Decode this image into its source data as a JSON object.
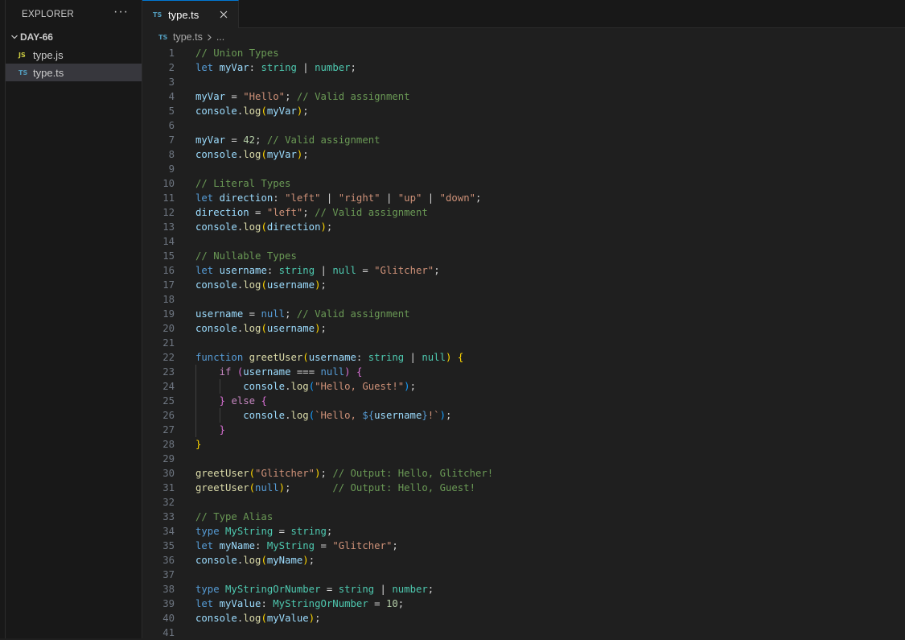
{
  "sidebar": {
    "title": "EXPLORER",
    "more_label": "···",
    "folder": "DAY-66",
    "files": [
      {
        "name": "type.js",
        "badge": "JS",
        "kind": "js",
        "selected": false
      },
      {
        "name": "type.ts",
        "badge": "TS",
        "kind": "ts",
        "selected": true
      }
    ]
  },
  "tab": {
    "badge": "TS",
    "label": "type.ts"
  },
  "breadcrumb": {
    "badge": "TS",
    "file": "type.ts",
    "tail": "..."
  },
  "colors": {
    "accent": "#0078d4",
    "comment": "#6a9955",
    "keyword": "#569cd6",
    "control": "#c586c0",
    "variable": "#9cdcfe",
    "type": "#4ec9b0",
    "string": "#ce9178",
    "number": "#b5cea8",
    "function": "#dcdcaa",
    "bracket1": "#ffd700",
    "bracket2": "#da70d6",
    "bracket3": "#179fff"
  },
  "code": {
    "lines": [
      [
        [
          "cm",
          "// Union Types"
        ]
      ],
      [
        [
          "kw",
          "let"
        ],
        [
          "op",
          " "
        ],
        [
          "var",
          "myVar"
        ],
        [
          "op",
          ": "
        ],
        [
          "ty",
          "string"
        ],
        [
          "op",
          " | "
        ],
        [
          "ty",
          "number"
        ],
        [
          "op",
          ";"
        ]
      ],
      [],
      [
        [
          "var",
          "myVar"
        ],
        [
          "op",
          " = "
        ],
        [
          "str",
          "\"Hello\""
        ],
        [
          "op",
          "; "
        ],
        [
          "cm",
          "// Valid assignment"
        ]
      ],
      [
        [
          "var",
          "console"
        ],
        [
          "op",
          "."
        ],
        [
          "fn",
          "log"
        ],
        [
          "p1",
          "("
        ],
        [
          "var",
          "myVar"
        ],
        [
          "p1",
          ")"
        ],
        [
          "op",
          ";"
        ]
      ],
      [],
      [
        [
          "var",
          "myVar"
        ],
        [
          "op",
          " = "
        ],
        [
          "num",
          "42"
        ],
        [
          "op",
          "; "
        ],
        [
          "cm",
          "// Valid assignment"
        ]
      ],
      [
        [
          "var",
          "console"
        ],
        [
          "op",
          "."
        ],
        [
          "fn",
          "log"
        ],
        [
          "p1",
          "("
        ],
        [
          "var",
          "myVar"
        ],
        [
          "p1",
          ")"
        ],
        [
          "op",
          ";"
        ]
      ],
      [],
      [
        [
          "cm",
          "// Literal Types"
        ]
      ],
      [
        [
          "kw",
          "let"
        ],
        [
          "op",
          " "
        ],
        [
          "var",
          "direction"
        ],
        [
          "op",
          ": "
        ],
        [
          "str",
          "\"left\""
        ],
        [
          "op",
          " | "
        ],
        [
          "str",
          "\"right\""
        ],
        [
          "op",
          " | "
        ],
        [
          "str",
          "\"up\""
        ],
        [
          "op",
          " | "
        ],
        [
          "str",
          "\"down\""
        ],
        [
          "op",
          ";"
        ]
      ],
      [
        [
          "var",
          "direction"
        ],
        [
          "op",
          " = "
        ],
        [
          "str",
          "\"left\""
        ],
        [
          "op",
          "; "
        ],
        [
          "cm",
          "// Valid assignment"
        ]
      ],
      [
        [
          "var",
          "console"
        ],
        [
          "op",
          "."
        ],
        [
          "fn",
          "log"
        ],
        [
          "p1",
          "("
        ],
        [
          "var",
          "direction"
        ],
        [
          "p1",
          ")"
        ],
        [
          "op",
          ";"
        ]
      ],
      [],
      [
        [
          "cm",
          "// Nullable Types"
        ]
      ],
      [
        [
          "kw",
          "let"
        ],
        [
          "op",
          " "
        ],
        [
          "var",
          "username"
        ],
        [
          "op",
          ": "
        ],
        [
          "ty",
          "string"
        ],
        [
          "op",
          " | "
        ],
        [
          "ty",
          "null"
        ],
        [
          "op",
          " = "
        ],
        [
          "str",
          "\"Glitcher\""
        ],
        [
          "op",
          ";"
        ]
      ],
      [
        [
          "var",
          "console"
        ],
        [
          "op",
          "."
        ],
        [
          "fn",
          "log"
        ],
        [
          "p1",
          "("
        ],
        [
          "var",
          "username"
        ],
        [
          "p1",
          ")"
        ],
        [
          "op",
          ";"
        ]
      ],
      [],
      [
        [
          "var",
          "username"
        ],
        [
          "op",
          " = "
        ],
        [
          "kw",
          "null"
        ],
        [
          "op",
          "; "
        ],
        [
          "cm",
          "// Valid assignment"
        ]
      ],
      [
        [
          "var",
          "console"
        ],
        [
          "op",
          "."
        ],
        [
          "fn",
          "log"
        ],
        [
          "p1",
          "("
        ],
        [
          "var",
          "username"
        ],
        [
          "p1",
          ")"
        ],
        [
          "op",
          ";"
        ]
      ],
      [],
      [
        [
          "kw",
          "function"
        ],
        [
          "op",
          " "
        ],
        [
          "fn",
          "greetUser"
        ],
        [
          "p1",
          "("
        ],
        [
          "var",
          "username"
        ],
        [
          "op",
          ": "
        ],
        [
          "ty",
          "string"
        ],
        [
          "op",
          " | "
        ],
        [
          "ty",
          "null"
        ],
        [
          "p1",
          ")"
        ],
        [
          "op",
          " "
        ],
        [
          "p1",
          "{"
        ]
      ],
      [
        [
          "op",
          "    "
        ],
        [
          "ctl",
          "if"
        ],
        [
          "op",
          " "
        ],
        [
          "p2",
          "("
        ],
        [
          "var",
          "username"
        ],
        [
          "op",
          " === "
        ],
        [
          "kw",
          "null"
        ],
        [
          "p2",
          ")"
        ],
        [
          "op",
          " "
        ],
        [
          "p2",
          "{"
        ]
      ],
      [
        [
          "op",
          "        "
        ],
        [
          "var",
          "console"
        ],
        [
          "op",
          "."
        ],
        [
          "fn",
          "log"
        ],
        [
          "p3",
          "("
        ],
        [
          "str",
          "\"Hello, Guest!\""
        ],
        [
          "p3",
          ")"
        ],
        [
          "op",
          ";"
        ]
      ],
      [
        [
          "op",
          "    "
        ],
        [
          "p2",
          "}"
        ],
        [
          "op",
          " "
        ],
        [
          "ctl",
          "else"
        ],
        [
          "op",
          " "
        ],
        [
          "p2",
          "{"
        ]
      ],
      [
        [
          "op",
          "        "
        ],
        [
          "var",
          "console"
        ],
        [
          "op",
          "."
        ],
        [
          "fn",
          "log"
        ],
        [
          "p3",
          "("
        ],
        [
          "str",
          "`Hello, "
        ],
        [
          "kw",
          "${"
        ],
        [
          "var",
          "username"
        ],
        [
          "kw",
          "}"
        ],
        [
          "str",
          "!`"
        ],
        [
          "p3",
          ")"
        ],
        [
          "op",
          ";"
        ]
      ],
      [
        [
          "op",
          "    "
        ],
        [
          "p2",
          "}"
        ]
      ],
      [
        [
          "p1",
          "}"
        ]
      ],
      [],
      [
        [
          "fn",
          "greetUser"
        ],
        [
          "p1",
          "("
        ],
        [
          "str",
          "\"Glitcher\""
        ],
        [
          "p1",
          ")"
        ],
        [
          "op",
          "; "
        ],
        [
          "cm",
          "// Output: Hello, Glitcher!"
        ]
      ],
      [
        [
          "fn",
          "greetUser"
        ],
        [
          "p1",
          "("
        ],
        [
          "kw",
          "null"
        ],
        [
          "p1",
          ")"
        ],
        [
          "op",
          ";       "
        ],
        [
          "cm",
          "// Output: Hello, Guest!"
        ]
      ],
      [],
      [
        [
          "cm",
          "// Type Alias"
        ]
      ],
      [
        [
          "kw",
          "type"
        ],
        [
          "op",
          " "
        ],
        [
          "ty",
          "MyString"
        ],
        [
          "op",
          " = "
        ],
        [
          "ty",
          "string"
        ],
        [
          "op",
          ";"
        ]
      ],
      [
        [
          "kw",
          "let"
        ],
        [
          "op",
          " "
        ],
        [
          "var",
          "myName"
        ],
        [
          "op",
          ": "
        ],
        [
          "ty",
          "MyString"
        ],
        [
          "op",
          " = "
        ],
        [
          "str",
          "\"Glitcher\""
        ],
        [
          "op",
          ";"
        ]
      ],
      [
        [
          "var",
          "console"
        ],
        [
          "op",
          "."
        ],
        [
          "fn",
          "log"
        ],
        [
          "p1",
          "("
        ],
        [
          "var",
          "myName"
        ],
        [
          "p1",
          ")"
        ],
        [
          "op",
          ";"
        ]
      ],
      [],
      [
        [
          "kw",
          "type"
        ],
        [
          "op",
          " "
        ],
        [
          "ty",
          "MyStringOrNumber"
        ],
        [
          "op",
          " = "
        ],
        [
          "ty",
          "string"
        ],
        [
          "op",
          " | "
        ],
        [
          "ty",
          "number"
        ],
        [
          "op",
          ";"
        ]
      ],
      [
        [
          "kw",
          "let"
        ],
        [
          "op",
          " "
        ],
        [
          "var",
          "myValue"
        ],
        [
          "op",
          ": "
        ],
        [
          "ty",
          "MyStringOrNumber"
        ],
        [
          "op",
          " = "
        ],
        [
          "num",
          "10"
        ],
        [
          "op",
          ";"
        ]
      ],
      [
        [
          "var",
          "console"
        ],
        [
          "op",
          "."
        ],
        [
          "fn",
          "log"
        ],
        [
          "p1",
          "("
        ],
        [
          "var",
          "myValue"
        ],
        [
          "p1",
          ")"
        ],
        [
          "op",
          ";"
        ]
      ],
      []
    ]
  }
}
